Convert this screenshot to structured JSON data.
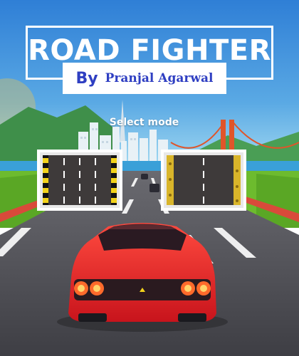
{
  "game": {
    "title": "ROAD FIGHTER",
    "by_label": "By",
    "author": "Pranjal Agarwal",
    "select_mode_label": "Select mode"
  },
  "modes": [
    {
      "id": "mode-1",
      "stripe_colors": [
        "#111111",
        "#f2d21b"
      ]
    },
    {
      "id": "mode-2",
      "stripe_colors": [
        "#d9b52a",
        "#f2d21b"
      ]
    }
  ],
  "icons": [
    "player-car",
    "city-skyline",
    "suspension-bridge",
    "traffic-car"
  ],
  "colors": {
    "sky_top": "#2f7fd6",
    "sky_bottom": "#8fd0f0",
    "title_text": "#ffffff",
    "byline_text": "#2f3fc2",
    "road": "#4a4a4e",
    "grass": "#6dbb2e",
    "car_body": "#e8262b",
    "bridge": "#e0552a"
  }
}
